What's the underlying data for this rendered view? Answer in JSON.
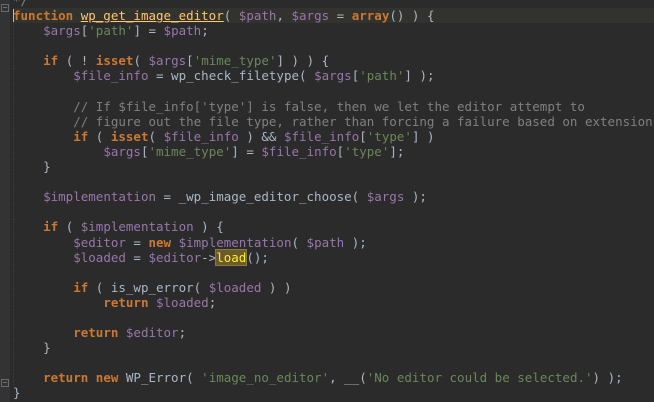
{
  "editor": {
    "language": "php",
    "colors": {
      "background": "#2b2b2b",
      "current_line": "#32332e",
      "keyword": "#cc7832",
      "variable": "#9876aa",
      "string": "#6a8759",
      "function_def": "#ffc66d",
      "comment": "#808080",
      "default": "#a9b7c6"
    },
    "lines": [
      {
        "indent": 0,
        "tokens": [
          {
            "t": "c",
            "v": "*/"
          }
        ]
      },
      {
        "indent": 0,
        "current": true,
        "tokens": [
          {
            "t": "k",
            "v": "function "
          },
          {
            "t": "f",
            "v": "wp_get_image_editor"
          },
          {
            "t": "p",
            "v": "( "
          },
          {
            "t": "v",
            "v": "$path"
          },
          {
            "t": "p",
            "v": ", "
          },
          {
            "t": "v",
            "v": "$args"
          },
          {
            "t": "p",
            "v": " = "
          },
          {
            "t": "k",
            "v": "array"
          },
          {
            "t": "p",
            "v": "() ) {"
          }
        ]
      },
      {
        "indent": 1,
        "tokens": [
          {
            "t": "v",
            "v": "$args"
          },
          {
            "t": "p",
            "v": "["
          },
          {
            "t": "s",
            "v": "'path'"
          },
          {
            "t": "p",
            "v": "] = "
          },
          {
            "t": "v",
            "v": "$path"
          },
          {
            "t": "p",
            "v": ";"
          }
        ]
      },
      {
        "indent": 1,
        "tokens": []
      },
      {
        "indent": 1,
        "tokens": [
          {
            "t": "k",
            "v": "if"
          },
          {
            "t": "p",
            "v": " ( ! "
          },
          {
            "t": "k",
            "v": "isset"
          },
          {
            "t": "p",
            "v": "( "
          },
          {
            "t": "v",
            "v": "$args"
          },
          {
            "t": "p",
            "v": "["
          },
          {
            "t": "s",
            "v": "'mime_type'"
          },
          {
            "t": "p",
            "v": "] ) ) {"
          }
        ]
      },
      {
        "indent": 2,
        "tokens": [
          {
            "t": "v",
            "v": "$file_info"
          },
          {
            "t": "p",
            "v": " = wp_check_filetype( "
          },
          {
            "t": "v",
            "v": "$args"
          },
          {
            "t": "p",
            "v": "["
          },
          {
            "t": "s",
            "v": "'path'"
          },
          {
            "t": "p",
            "v": "] );"
          }
        ]
      },
      {
        "indent": 2,
        "tokens": []
      },
      {
        "indent": 2,
        "tokens": [
          {
            "t": "c",
            "v": "// If $file_info['type'] is false, then we let the editor attempt to"
          }
        ]
      },
      {
        "indent": 2,
        "tokens": [
          {
            "t": "c",
            "v": "// figure out the file type, rather than forcing a failure based on extension."
          }
        ]
      },
      {
        "indent": 2,
        "tokens": [
          {
            "t": "k",
            "v": "if"
          },
          {
            "t": "p",
            "v": " ( "
          },
          {
            "t": "k",
            "v": "isset"
          },
          {
            "t": "p",
            "v": "( "
          },
          {
            "t": "v",
            "v": "$file_info"
          },
          {
            "t": "p",
            "v": " ) && "
          },
          {
            "t": "v",
            "v": "$file_info"
          },
          {
            "t": "p",
            "v": "["
          },
          {
            "t": "s",
            "v": "'type'"
          },
          {
            "t": "p",
            "v": "] )"
          }
        ]
      },
      {
        "indent": 3,
        "tokens": [
          {
            "t": "v",
            "v": "$args"
          },
          {
            "t": "p",
            "v": "["
          },
          {
            "t": "s",
            "v": "'mime_type'"
          },
          {
            "t": "p",
            "v": "] = "
          },
          {
            "t": "v",
            "v": "$file_info"
          },
          {
            "t": "p",
            "v": "["
          },
          {
            "t": "s",
            "v": "'type'"
          },
          {
            "t": "p",
            "v": "];"
          }
        ]
      },
      {
        "indent": 1,
        "tokens": [
          {
            "t": "p",
            "v": "}"
          }
        ]
      },
      {
        "indent": 1,
        "tokens": []
      },
      {
        "indent": 1,
        "tokens": [
          {
            "t": "v",
            "v": "$implementation"
          },
          {
            "t": "p",
            "v": " = _wp_image_editor_choose( "
          },
          {
            "t": "v",
            "v": "$args"
          },
          {
            "t": "p",
            "v": " );"
          }
        ]
      },
      {
        "indent": 1,
        "tokens": []
      },
      {
        "indent": 1,
        "tokens": [
          {
            "t": "k",
            "v": "if"
          },
          {
            "t": "p",
            "v": " ( "
          },
          {
            "t": "v",
            "v": "$implementation"
          },
          {
            "t": "p",
            "v": " ) {"
          }
        ]
      },
      {
        "indent": 2,
        "tokens": [
          {
            "t": "v",
            "v": "$editor"
          },
          {
            "t": "p",
            "v": " = "
          },
          {
            "t": "k",
            "v": "new "
          },
          {
            "t": "v",
            "v": "$implementation"
          },
          {
            "t": "p",
            "v": "( "
          },
          {
            "t": "v",
            "v": "$path"
          },
          {
            "t": "p",
            "v": " );"
          }
        ]
      },
      {
        "indent": 2,
        "tokens": [
          {
            "t": "v",
            "v": "$loaded"
          },
          {
            "t": "p",
            "v": " = "
          },
          {
            "t": "v",
            "v": "$editor"
          },
          {
            "t": "p",
            "v": "->"
          },
          {
            "t": "h",
            "v": "load"
          },
          {
            "t": "p",
            "v": "();"
          }
        ]
      },
      {
        "indent": 2,
        "tokens": []
      },
      {
        "indent": 2,
        "tokens": [
          {
            "t": "k",
            "v": "if"
          },
          {
            "t": "p",
            "v": " ( is_wp_error( "
          },
          {
            "t": "v",
            "v": "$loaded"
          },
          {
            "t": "p",
            "v": " ) )"
          }
        ]
      },
      {
        "indent": 3,
        "tokens": [
          {
            "t": "k",
            "v": "return "
          },
          {
            "t": "v",
            "v": "$loaded"
          },
          {
            "t": "p",
            "v": ";"
          }
        ]
      },
      {
        "indent": 2,
        "tokens": []
      },
      {
        "indent": 2,
        "tokens": [
          {
            "t": "k",
            "v": "return "
          },
          {
            "t": "v",
            "v": "$editor"
          },
          {
            "t": "p",
            "v": ";"
          }
        ]
      },
      {
        "indent": 1,
        "tokens": [
          {
            "t": "p",
            "v": "}"
          }
        ]
      },
      {
        "indent": 1,
        "tokens": []
      },
      {
        "indent": 1,
        "tokens": [
          {
            "t": "k",
            "v": "return new "
          },
          {
            "t": "p",
            "v": "WP_Error( "
          },
          {
            "t": "s",
            "v": "'image_no_editor'"
          },
          {
            "t": "p",
            "v": ", __("
          },
          {
            "t": "s",
            "v": "'No editor could be selected.'"
          },
          {
            "t": "p",
            "v": ") );"
          }
        ]
      },
      {
        "indent": 0,
        "tokens": [
          {
            "t": "p",
            "v": "}"
          }
        ]
      }
    ]
  }
}
